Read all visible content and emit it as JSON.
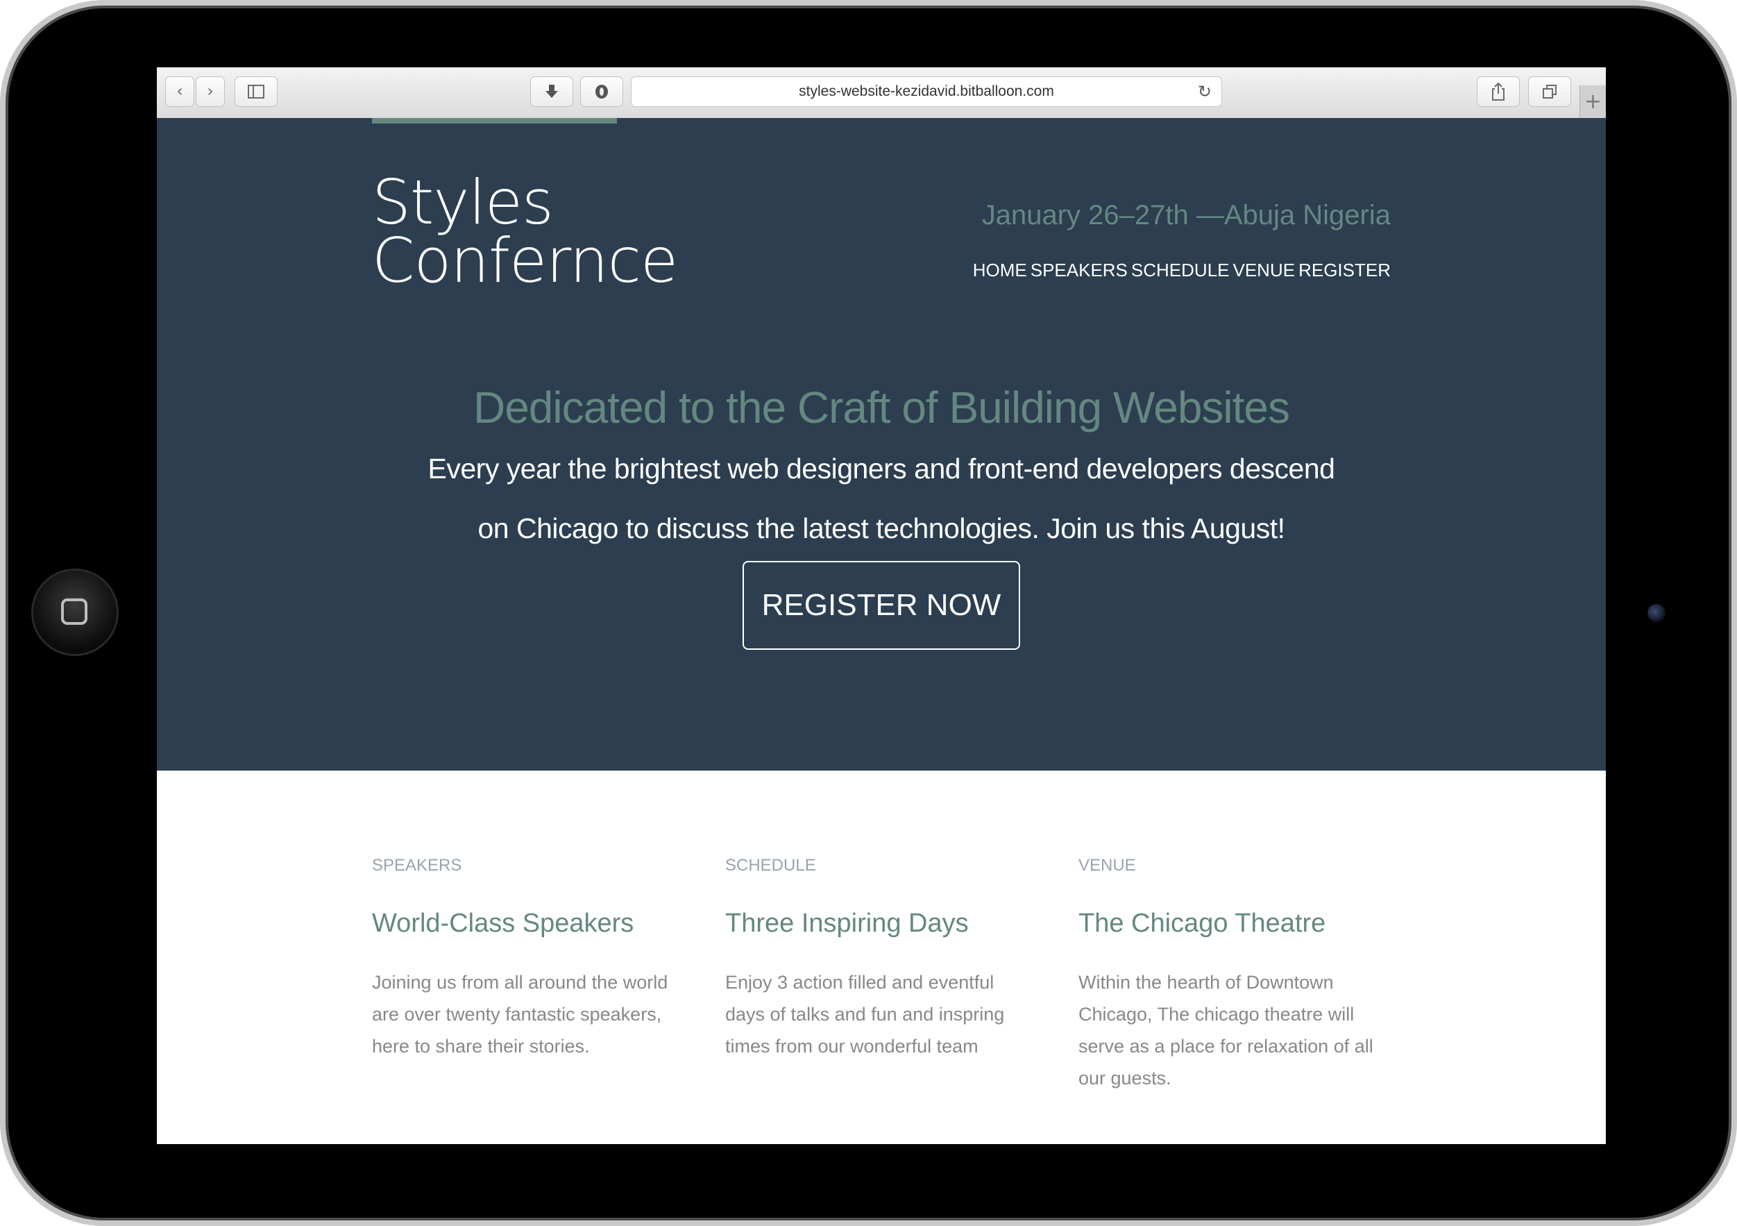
{
  "browser": {
    "url": "styles-website-kezidavid.bitballoon.com",
    "icons": {
      "back": "chevron-left-icon",
      "forward": "chevron-right-icon",
      "sidebar": "sidebar-icon",
      "download": "download-icon",
      "extension": "shield-icon",
      "reload": "reload-icon",
      "share": "share-icon",
      "tabs": "tabs-icon",
      "new_tab": "plus-icon"
    }
  },
  "header": {
    "logo_line1": "Styles",
    "logo_line2": "Confernce",
    "date_location": "January 26–27th —Abuja Nigeria",
    "nav": [
      "HOME",
      "SPEAKERS",
      "SCHEDULE",
      "VENUE",
      "REGISTER"
    ]
  },
  "hero": {
    "heading": "Dedicated to the Craft of Building Websites",
    "text": "Every year the brightest web designers and front-end developers descend on Chicago to discuss the latest technologies. Join us this August!",
    "cta": "REGISTER NOW"
  },
  "teasers": [
    {
      "eyebrow": "SPEAKERS",
      "title": "World-Class Speakers",
      "body": "Joining us from all around the world are over twenty fantastic speakers, here to share their stories."
    },
    {
      "eyebrow": "SCHEDULE",
      "title": "Three Inspiring Days",
      "body": "Enjoy 3 action filled and eventful days of talks and fun and inspring times from our wonderful team"
    },
    {
      "eyebrow": "VENUE",
      "title": "The Chicago Theatre",
      "body": "Within the hearth of Downtown Chicago, The chicago theatre will serve as a place for relaxation of all our guests."
    }
  ],
  "colors": {
    "hero_background": "#2c3e50",
    "accent": "#648880",
    "page_background": "#ffffff"
  }
}
